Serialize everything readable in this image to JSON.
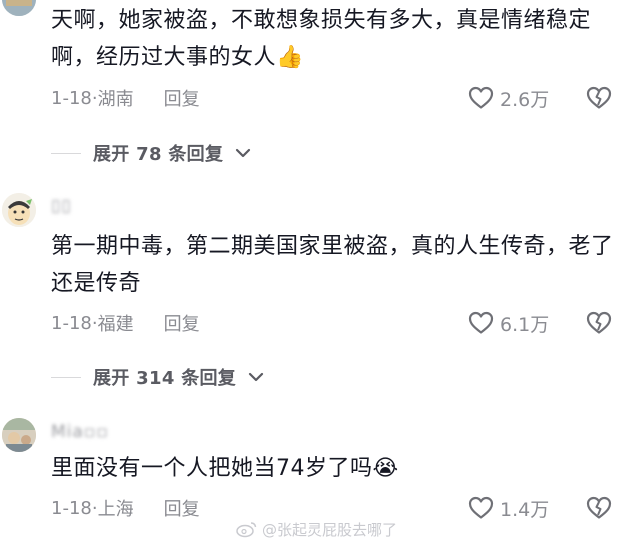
{
  "comments": [
    {
      "text": "天啊，她家被盗，不敢想象损失有多大，真是情绪稳定啊，经历过大事的女人👍",
      "date": "1-18",
      "location": "湖南",
      "reply_label": "回复",
      "likes": "2.6万",
      "expand_label": "展开 78 条回复"
    },
    {
      "username": "▯▯",
      "text": "第一期中毒，第二期美国家里被盗，真的人生传奇，老了还是传奇",
      "date": "1-18",
      "location": "福建",
      "reply_label": "回复",
      "likes": "6.1万",
      "expand_label": "展开 314 条回复"
    },
    {
      "username": "Mia▫▫",
      "text": "里面没有一个人把她当74岁了吗😭",
      "date": "1-18",
      "location": "上海",
      "reply_label": "回复",
      "likes": "1.4万"
    }
  ],
  "separator": "·",
  "watermark": "@张起灵屁股去哪了",
  "colors": {
    "text": "#161823",
    "meta": "#8a8b91",
    "expand": "#5a5b62"
  }
}
